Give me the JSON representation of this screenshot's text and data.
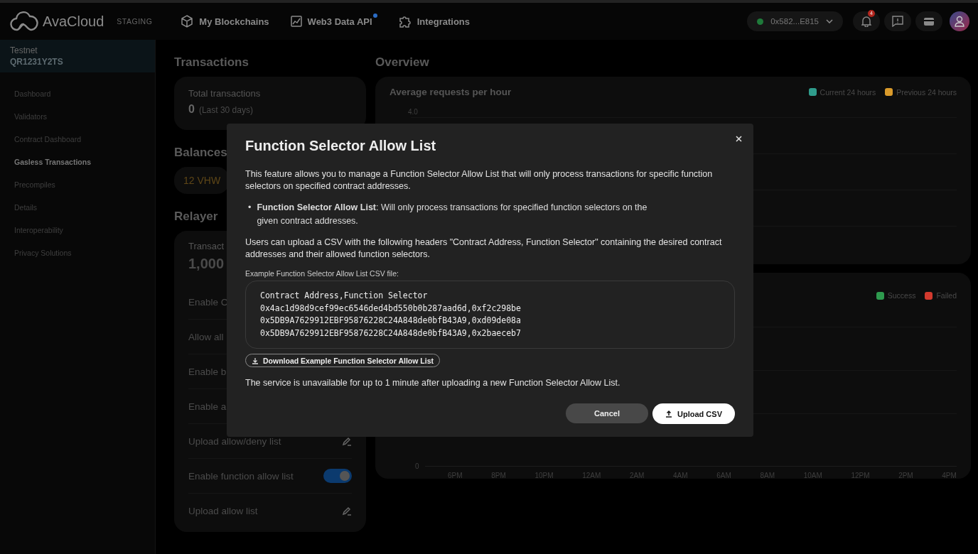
{
  "topbar": {
    "brand": "AvaCloud",
    "environment": "STAGING",
    "nav": [
      {
        "label": "My Blockchains",
        "dot": false
      },
      {
        "label": "Web3 Data API",
        "dot": true
      },
      {
        "label": "Integrations",
        "dot": false
      }
    ],
    "wallet": {
      "address": "0x582...E815",
      "connected": true
    },
    "notifications": {
      "count": "4"
    }
  },
  "sidebar": {
    "network": "Testnet",
    "chain_id": "QR1231Y2TS",
    "items": [
      {
        "label": "Dashboard",
        "selected": false
      },
      {
        "label": "Validators",
        "selected": false
      },
      {
        "label": "Contract Dashboard",
        "selected": false
      },
      {
        "label": "Gasless Transactions",
        "selected": true
      },
      {
        "label": "Precompiles",
        "selected": false
      },
      {
        "label": "Details",
        "selected": false
      },
      {
        "label": "Interoperability",
        "selected": false
      },
      {
        "label": "Privacy Solutions",
        "selected": false
      }
    ]
  },
  "transactions": {
    "heading": "Transactions",
    "label": "Total transactions",
    "value": "0",
    "period": "(Last 30 days)"
  },
  "balances": {
    "heading": "Balances",
    "value": "12 VHW"
  },
  "relayer": {
    "heading": "Relayer",
    "stat_label": "Transact",
    "stat_value": "1,000",
    "settings": [
      {
        "kind": "cut",
        "label": "Enable C"
      },
      {
        "kind": "cut",
        "label": "Allow all"
      },
      {
        "kind": "cut",
        "label": "Enable b"
      },
      {
        "kind": "cut",
        "label": "Enable a"
      },
      {
        "kind": "edit",
        "label": "Upload allow/deny list"
      },
      {
        "kind": "toggle",
        "label": "Enable function allow list",
        "on": true
      },
      {
        "kind": "edit",
        "label": "Upload allow list"
      }
    ]
  },
  "overview": {
    "heading": "Overview",
    "requests_chart": {
      "title": "Average requests per hour",
      "ytick": "4.0",
      "legend": [
        {
          "label": "Current 24 hours",
          "color": "#2f9c8c"
        },
        {
          "label": "Previous 24 hours",
          "color": "#d99a2b"
        }
      ]
    },
    "status_chart": {
      "ytick": "0",
      "legend": [
        {
          "label": "Success",
          "color": "#2e9a4e"
        },
        {
          "label": "Failed",
          "color": "#d23a2e"
        }
      ],
      "xticks": [
        "6PM",
        "8PM",
        "10PM",
        "12AM",
        "2AM",
        "4AM",
        "6AM",
        "8AM",
        "10AM",
        "12PM",
        "2PM",
        "4PM"
      ]
    }
  },
  "dialog": {
    "title": "Function Selector Allow List",
    "intro": "This feature allows you to manage a Function Selector Allow List that will only process transactions for specific function selectors on specified contract addresses.",
    "bullets": [
      {
        "marker": "•",
        "text": "**Function Selector Allow List**: Will only process transactions for specified function selectors on the given contract addresses."
      }
    ],
    "csv_note": "Users can upload a CSV with the following headers \"Contract Address, Function Selector\" containing the desired contract addresses and their allowed function selectors.",
    "example_label": "Example Function Selector Allow List CSV file:",
    "example_lines": [
      "Contract Address,Function Selector",
      "0x4ac1d98d9cef99ec6546ded4bd550b0b287aad6d,0xf2c298be",
      "0x5DB9A7629912EBF95876228C24A848de0bfB43A9,0xd09de08a",
      "0x5DB9A7629912EBF95876228C24A848de0bfB43A9,0x2baeceb7"
    ],
    "download_label": "Download Example Function Selector Allow List",
    "warning": "The service is unavailable for up to 1 minute after uploading a new Function Selector Allow List.",
    "cancel_label": "Cancel",
    "upload_label": "Upload CSV"
  }
}
